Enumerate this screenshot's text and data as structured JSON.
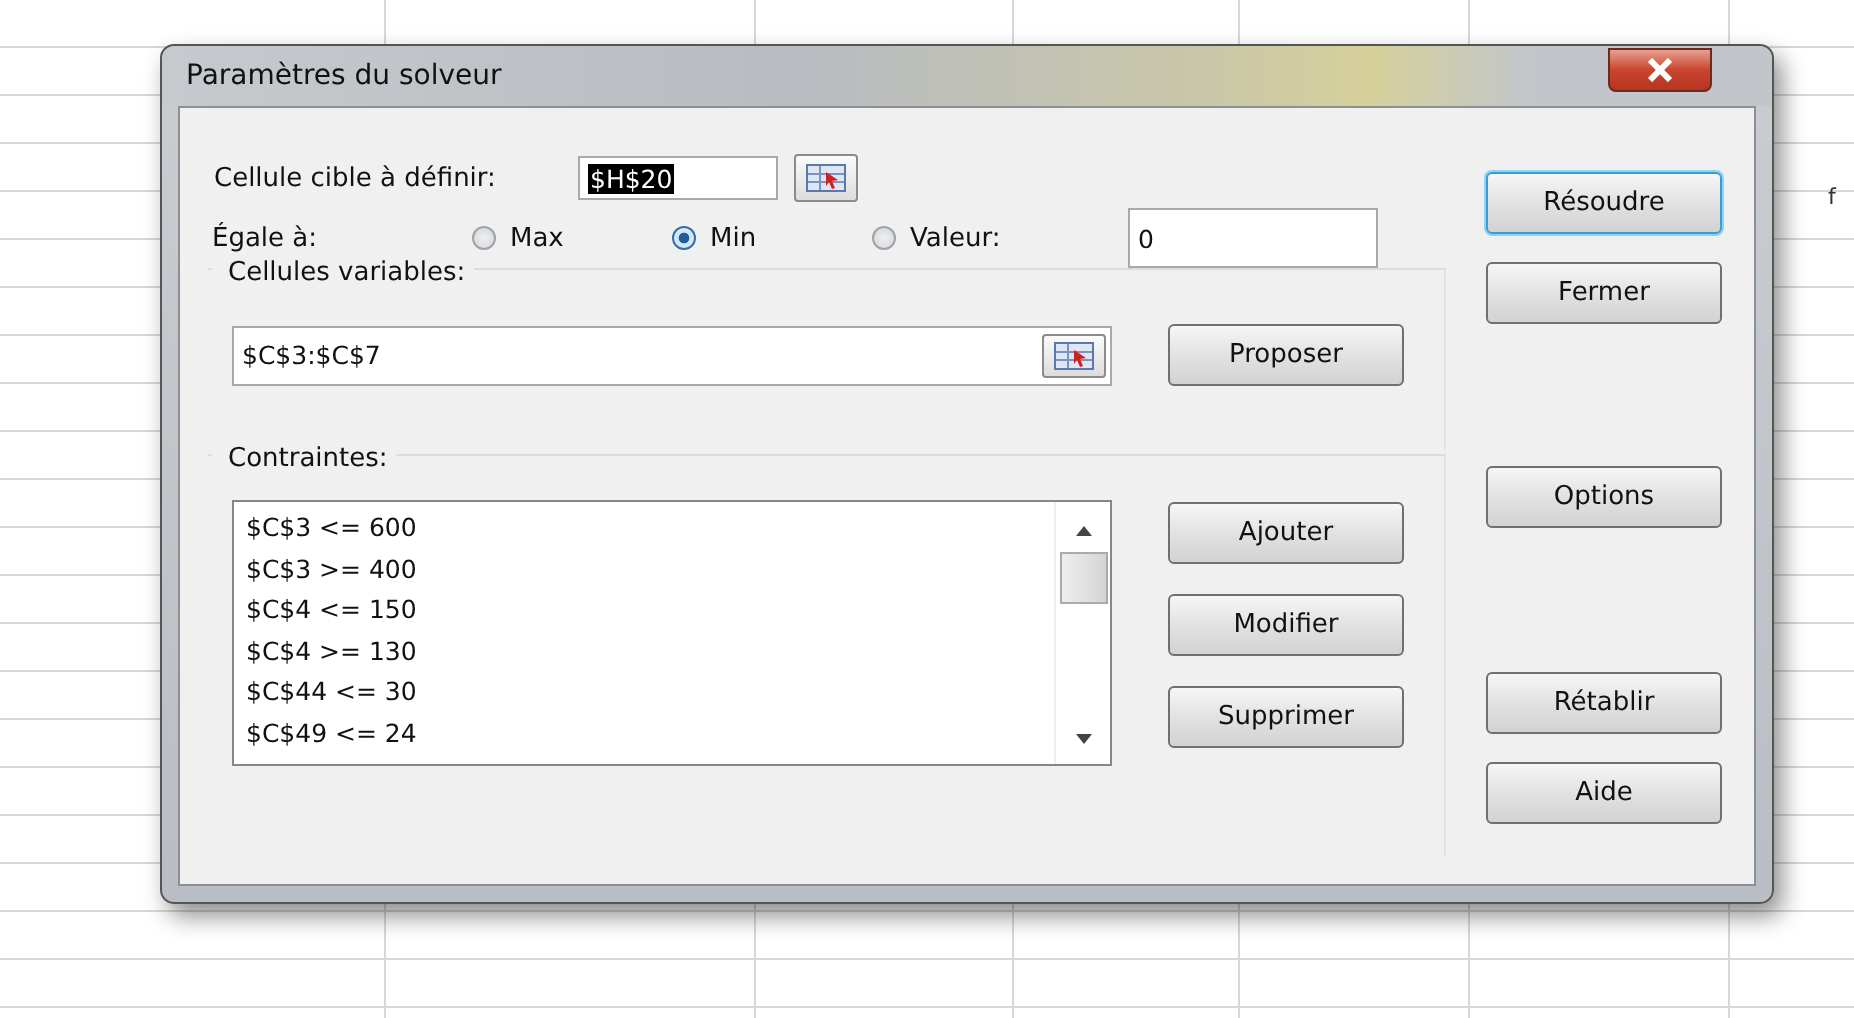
{
  "spreadsheet": {
    "cell_text": "f"
  },
  "window": {
    "title": "Paramètres du solveur"
  },
  "target": {
    "label": "Cellule cible à définir:",
    "value": "$H$20",
    "selected": true
  },
  "equal_to": {
    "label": "Égale à:",
    "options": [
      {
        "label": "Max",
        "selected": false
      },
      {
        "label": "Min",
        "selected": true
      },
      {
        "label": "Valeur:",
        "selected": false
      }
    ],
    "value": "0"
  },
  "variable_cells": {
    "label": "Cellules variables:",
    "value": "$C$3:$C$7",
    "button": "Proposer"
  },
  "constraints": {
    "label": "Contraintes:",
    "items": [
      "$C$3 <= 600",
      "$C$3 >= 400",
      "$C$4 <= 150",
      "$C$4 >= 130",
      "$C$44 <= 30",
      "$C$49 <= 24"
    ],
    "buttons": [
      "Ajouter",
      "Modifier",
      "Supprimer"
    ]
  },
  "side_buttons": [
    {
      "label": "Résoudre",
      "focused": true
    },
    {
      "label": "Fermer",
      "focused": false
    },
    {
      "label": "Options",
      "focused": false
    },
    {
      "label": "Rétablir",
      "focused": false
    },
    {
      "label": "Aide",
      "focused": false
    }
  ]
}
